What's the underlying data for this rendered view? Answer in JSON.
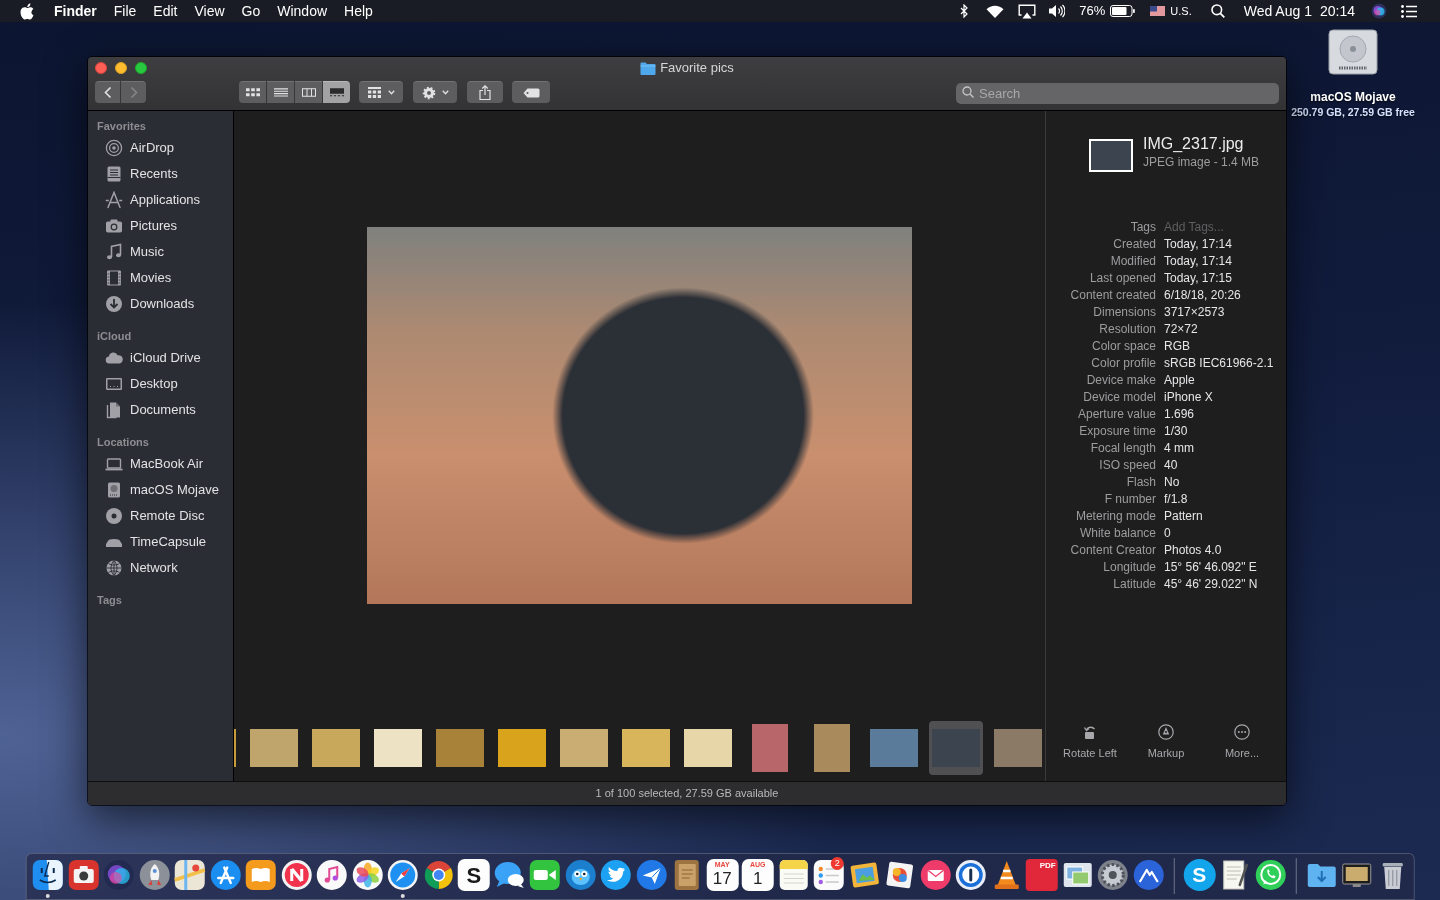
{
  "menu_bar": {
    "app_name": "Finder",
    "menus": [
      "File",
      "Edit",
      "View",
      "Go",
      "Window",
      "Help"
    ],
    "battery": "76%",
    "input_source": "U.S.",
    "date": "Wed Aug 1",
    "time": "20:14"
  },
  "desktop_icons": [
    {
      "label": "macOS Mojave",
      "info": "250.79 GB, 27.59 GB free"
    }
  ],
  "window": {
    "title": "Favorite pics"
  },
  "toolbar": {
    "nav": [
      {
        "kind": "back",
        "disabled": false
      },
      {
        "kind": "forward",
        "disabled": true
      }
    ],
    "view_modes": [
      {
        "kind": "icons",
        "selected": false
      },
      {
        "kind": "list",
        "selected": false
      },
      {
        "kind": "columns",
        "selected": false
      },
      {
        "kind": "gallery",
        "selected": true
      }
    ],
    "buttons": [
      {
        "kind": "group"
      },
      {
        "kind": "action"
      },
      {
        "kind": "share"
      },
      {
        "kind": "tags"
      }
    ],
    "search": {
      "placeholder": "Search"
    }
  },
  "sidebar": {
    "sections": [
      {
        "heading": "Favorites",
        "items": [
          {
            "label": "AirDrop",
            "kind": "airdrop",
            "selected": false
          },
          {
            "label": "Recents",
            "kind": "recents",
            "selected": false
          },
          {
            "label": "Applications",
            "kind": "applications",
            "selected": false
          },
          {
            "label": "Pictures",
            "kind": "pictures",
            "selected": false
          },
          {
            "label": "Music",
            "kind": "music",
            "selected": false
          },
          {
            "label": "Movies",
            "kind": "movies",
            "selected": false
          },
          {
            "label": "Downloads",
            "kind": "downloads",
            "selected": false
          }
        ]
      },
      {
        "heading": "iCloud",
        "items": [
          {
            "label": "iCloud Drive",
            "kind": "icloud",
            "selected": false
          },
          {
            "label": "Desktop",
            "kind": "desktop",
            "selected": false
          },
          {
            "label": "Documents",
            "kind": "documents",
            "selected": false
          }
        ]
      },
      {
        "heading": "Locations",
        "items": [
          {
            "label": "MacBook Air",
            "kind": "macbook",
            "selected": false
          },
          {
            "label": "macOS Mojave",
            "kind": "disk",
            "selected": false
          },
          {
            "label": "Remote Disc",
            "kind": "remotedisc",
            "selected": false
          },
          {
            "label": "TimeCapsule",
            "kind": "timecapsule",
            "selected": false
          },
          {
            "label": "Network",
            "kind": "network",
            "selected": false
          }
        ]
      },
      {
        "heading": "Tags"
      }
    ]
  },
  "gallery": {
    "thumbnails": [
      {
        "kind": "landscape",
        "selected": false
      },
      {
        "kind": "landscape",
        "selected": false
      },
      {
        "kind": "landscape",
        "selected": false
      },
      {
        "kind": "landscape",
        "selected": false
      },
      {
        "kind": "landscape",
        "selected": false
      },
      {
        "kind": "landscape",
        "selected": false
      },
      {
        "kind": "landscape",
        "selected": false
      },
      {
        "kind": "landscape",
        "selected": false
      },
      {
        "kind": "landscape",
        "selected": false
      },
      {
        "kind": "portrait",
        "selected": false
      },
      {
        "kind": "portrait",
        "selected": false
      },
      {
        "kind": "landscape",
        "selected": false
      },
      {
        "kind": "landscape",
        "selected": true
      },
      {
        "kind": "landscape",
        "selected": false
      }
    ]
  },
  "info_panel": {
    "file_name": "IMG_2317.jpg",
    "file_type": "JPEG image - 1.4 MB",
    "tags": {
      "label": "Tags",
      "placeholder": "Add Tags..."
    },
    "metadata": [
      {
        "label": "Created",
        "value": "Today, 17:14"
      },
      {
        "label": "Modified",
        "value": "Today, 17:14"
      },
      {
        "label": "Last opened",
        "value": "Today, 17:15"
      },
      {
        "label": "Content created",
        "value": "6/18/18, 20:26"
      },
      {
        "label": "Dimensions",
        "value": "3717×2573"
      },
      {
        "label": "Resolution",
        "value": "72×72"
      },
      {
        "label": "Color space",
        "value": "RGB"
      },
      {
        "label": "Color profile",
        "value": "sRGB IEC61966-2.1"
      },
      {
        "label": "Device make",
        "value": "Apple"
      },
      {
        "label": "Device model",
        "value": "iPhone X"
      },
      {
        "label": "Aperture value",
        "value": "1.696"
      },
      {
        "label": "Exposure time",
        "value": "1/30"
      },
      {
        "label": "Focal length",
        "value": "4 mm"
      },
      {
        "label": "ISO speed",
        "value": "40"
      },
      {
        "label": "Flash",
        "value": "No"
      },
      {
        "label": "F number",
        "value": "f/1.8"
      },
      {
        "label": "Metering mode",
        "value": "Pattern"
      },
      {
        "label": "White balance",
        "value": "0"
      },
      {
        "label": "Content Creator",
        "value": "Photos 4.0"
      },
      {
        "label": "Longitude",
        "value": "15° 56' 46.092\" E"
      },
      {
        "label": "Latitude",
        "value": "45° 46' 29.022\" N"
      }
    ],
    "quick_actions": [
      {
        "label": "Rotate Left",
        "kind": "rotate"
      },
      {
        "label": "Markup",
        "kind": "markup"
      },
      {
        "label": "More...",
        "kind": "more"
      }
    ]
  },
  "status_bar": "1 of 100 selected, 27.59 GB available",
  "dock": {
    "sections": [
      [
        {
          "kind": "finder",
          "running": true
        },
        {
          "kind": "camera",
          "running": false
        },
        {
          "kind": "orb",
          "running": false
        },
        {
          "kind": "rocket",
          "running": false
        },
        {
          "kind": "map",
          "running": false
        },
        {
          "kind": "tools",
          "running": false
        },
        {
          "kind": "book",
          "running": false
        },
        {
          "kind": "news",
          "running": false
        },
        {
          "kind": "note",
          "running": false
        },
        {
          "kind": "flower",
          "running": false
        },
        {
          "kind": "compass",
          "running": true
        },
        {
          "kind": "ring",
          "running": false
        },
        {
          "kind": "letter",
          "glyph": "S",
          "running": false
        },
        {
          "kind": "bubbles",
          "running": false
        },
        {
          "kind": "video",
          "running": false
        },
        {
          "kind": "bird",
          "running": false
        },
        {
          "kind": "bluebird",
          "running": false
        },
        {
          "kind": "plane",
          "running": false
        },
        {
          "kind": "notebook",
          "running": false
        },
        {
          "kind": "calendar",
          "month": "MAY",
          "day": "17",
          "running": false
        },
        {
          "kind": "calendar",
          "month": "AUG",
          "day": "1",
          "running": false
        },
        {
          "kind": "notes",
          "running": false
        },
        {
          "kind": "reminders",
          "badge": "2",
          "running": false
        },
        {
          "kind": "frames",
          "running": false
        },
        {
          "kind": "picture",
          "running": false
        },
        {
          "kind": "mail",
          "running": false
        },
        {
          "kind": "keyhole",
          "running": false
        },
        {
          "kind": "cone",
          "running": false
        },
        {
          "kind": "pdf",
          "glyph": "PDF",
          "running": false
        },
        {
          "kind": "preview",
          "running": false
        },
        {
          "kind": "settings",
          "running": false
        },
        {
          "kind": "mountain",
          "running": false
        }
      ],
      [
        {
          "kind": "skype",
          "glyph": "S",
          "running": false
        },
        {
          "kind": "textedit",
          "running": false
        },
        {
          "kind": "chat",
          "running": false
        }
      ],
      [
        {
          "kind": "folder",
          "running": false
        },
        {
          "kind": "screen",
          "running": false
        },
        {
          "kind": "trash",
          "running": false
        }
      ]
    ]
  }
}
